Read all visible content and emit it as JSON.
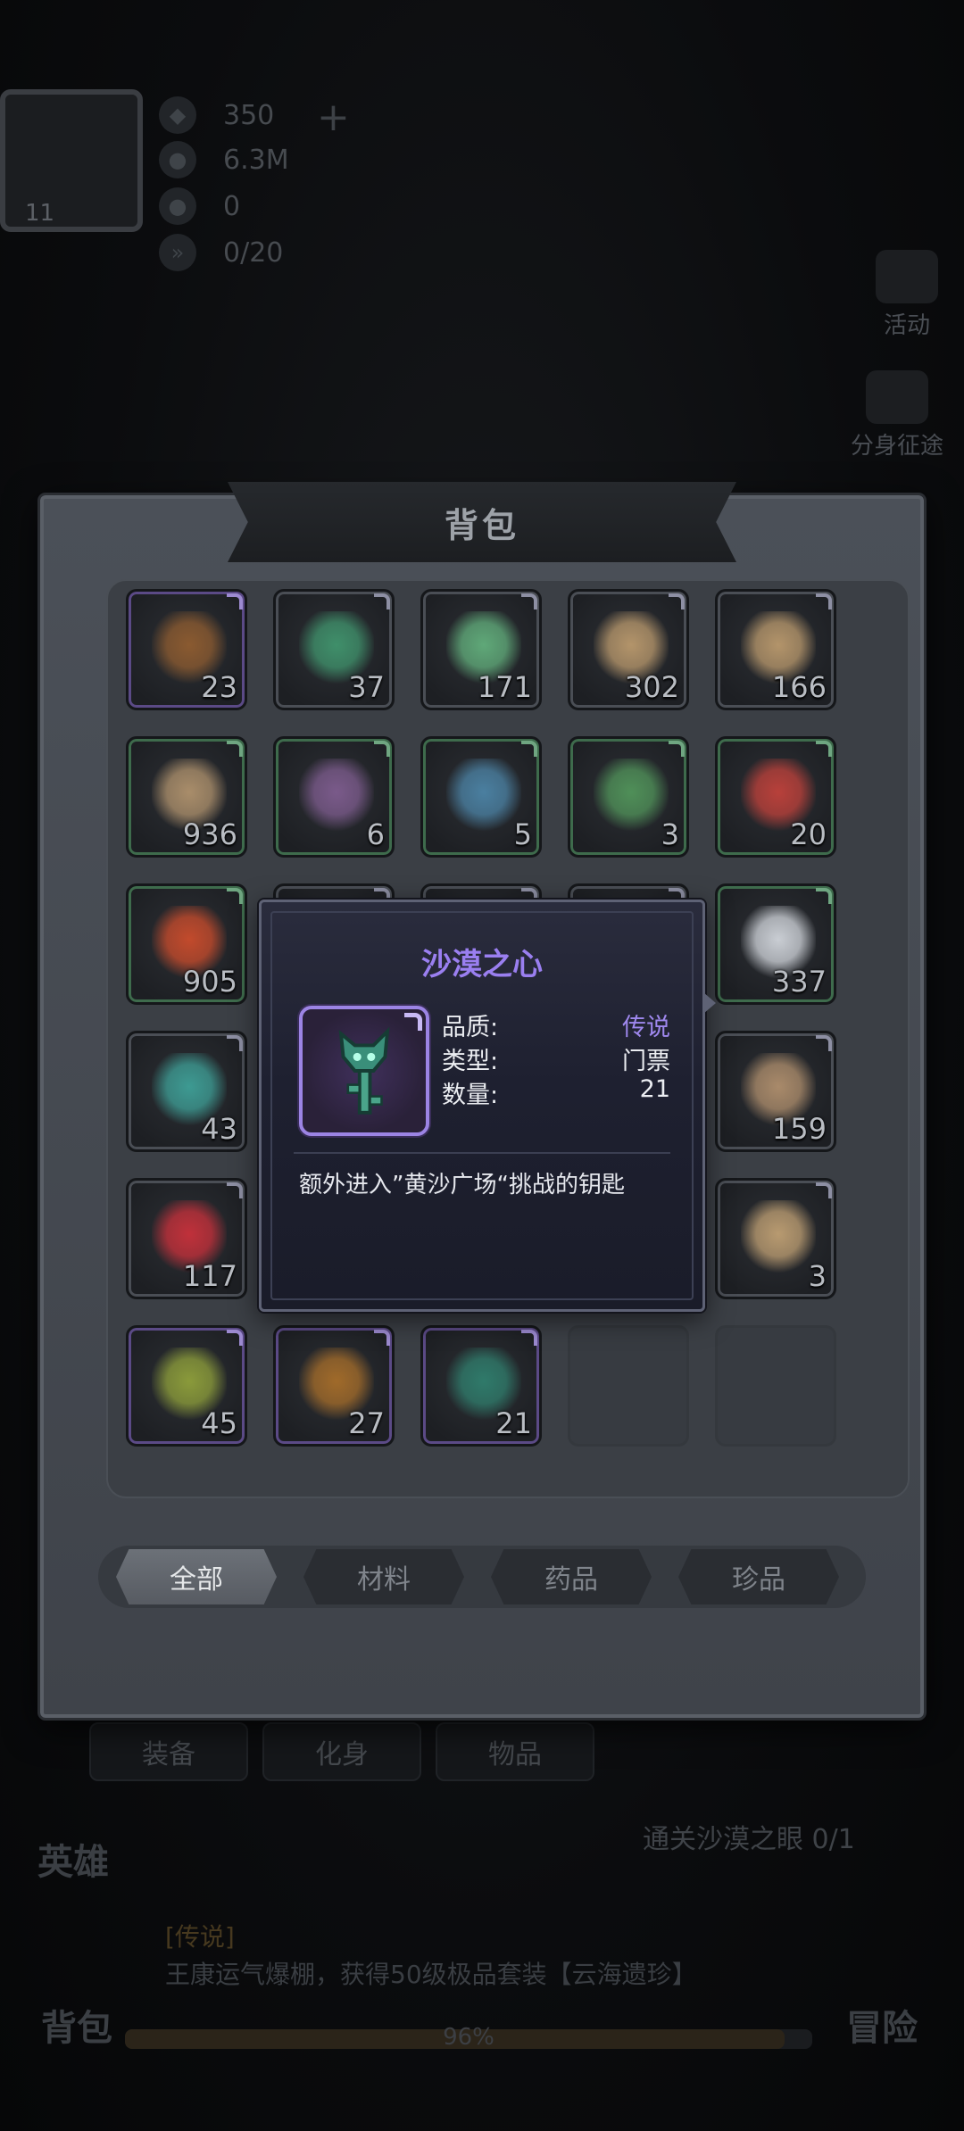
{
  "hud": {
    "level": "11",
    "resources": [
      {
        "icon": "diamond-icon",
        "value": "350"
      },
      {
        "icon": "gold-coin-icon",
        "value": "6.3M"
      },
      {
        "icon": "token-icon",
        "value": "0"
      },
      {
        "icon": "stamina-icon",
        "value": "0/20"
      }
    ],
    "side_buttons": [
      {
        "icon": "activity-icon",
        "label": "活动"
      },
      {
        "icon": "arena-icon",
        "label": "分身征途"
      }
    ]
  },
  "background": {
    "bottom_tabs": [
      "装备",
      "化身",
      "物品"
    ],
    "quest_text": "通关沙漠之眼 0/1",
    "chat_prefix": "[传说]",
    "chat_text": "王康运气爆棚，获得50级极品套装【云海遗珍】",
    "nav_left": "英雄",
    "nav_bag": "背包",
    "nav_right": "冒险",
    "exp_percent": 96,
    "exp_text": "96%"
  },
  "backpack": {
    "title": "背包",
    "items": [
      {
        "name": "winged-boots",
        "count": "23",
        "quality": "purple"
      },
      {
        "name": "green-crystal-chest",
        "count": "37",
        "quality": "gray"
      },
      {
        "name": "green-shard",
        "count": "171",
        "quality": "gray"
      },
      {
        "name": "sword-scroll",
        "count": "302",
        "quality": "gray"
      },
      {
        "name": "sword-scroll-2",
        "count": "166",
        "quality": "gray"
      },
      {
        "name": "parchment",
        "count": "936",
        "quality": "green"
      },
      {
        "name": "purple-rune-compass",
        "count": "6",
        "quality": "green"
      },
      {
        "name": "blue-rune-compass",
        "count": "5",
        "quality": "green"
      },
      {
        "name": "green-rune-ring",
        "count": "3",
        "quality": "green"
      },
      {
        "name": "red-shield-gem",
        "count": "20",
        "quality": "green"
      },
      {
        "name": "red-crest-badge",
        "count": "905",
        "quality": "green"
      },
      {
        "name": "hidden-1",
        "count": "",
        "quality": "gray"
      },
      {
        "name": "hidden-2",
        "count": "",
        "quality": "gray"
      },
      {
        "name": "hidden-3",
        "count": "",
        "quality": "gray"
      },
      {
        "name": "white-crystal-pile",
        "count": "337",
        "quality": "green"
      },
      {
        "name": "teal-shield-gem",
        "count": "43",
        "quality": "gray"
      },
      {
        "name": "hidden-4",
        "count": "",
        "quality": "gray"
      },
      {
        "name": "hidden-5",
        "count": "",
        "quality": "gray"
      },
      {
        "name": "hidden-6",
        "count": "",
        "quality": "gray"
      },
      {
        "name": "sand-shell",
        "count": "159",
        "quality": "gray"
      },
      {
        "name": "red-card",
        "count": "117",
        "quality": "gray"
      },
      {
        "name": "hidden-7",
        "count": "",
        "quality": "gray"
      },
      {
        "name": "hidden-8",
        "count": "",
        "quality": "gray"
      },
      {
        "name": "hidden-9",
        "count": "",
        "quality": "gray"
      },
      {
        "name": "ancient-scroll",
        "count": "3",
        "quality": "gray"
      },
      {
        "name": "green-key",
        "count": "45",
        "quality": "purple"
      },
      {
        "name": "orange-key",
        "count": "27",
        "quality": "purple"
      },
      {
        "name": "desert-heart-key",
        "count": "21",
        "quality": "purple"
      },
      {
        "name": "empty",
        "count": "",
        "quality": "empty"
      },
      {
        "name": "empty",
        "count": "",
        "quality": "empty"
      }
    ],
    "filters": [
      {
        "label": "全部",
        "active": true
      },
      {
        "label": "材料",
        "active": false
      },
      {
        "label": "药品",
        "active": false
      },
      {
        "label": "珍品",
        "active": false
      }
    ]
  },
  "tooltip": {
    "title": "沙漠之心",
    "quality_label": "品质:",
    "quality_value": "传说",
    "type_label": "类型:",
    "type_value": "门票",
    "count_label": "数量:",
    "count_value": "21",
    "description": "额外进入”黄沙广场“挑战的钥匙",
    "colors": {
      "legend": "#9f88ee",
      "title": "#9a7ff0"
    }
  }
}
